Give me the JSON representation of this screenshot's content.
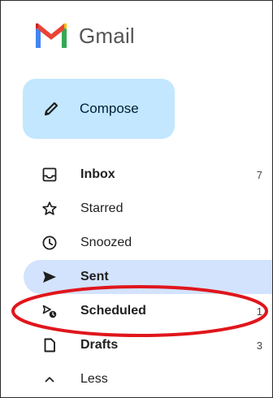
{
  "app": {
    "title": "Gmail",
    "logo_icon": "gmail-logo-icon"
  },
  "compose": {
    "label": "Compose",
    "icon": "pencil-icon",
    "color": "#c2e7ff"
  },
  "nav": {
    "items": [
      {
        "id": "inbox",
        "label": "Inbox",
        "icon": "inbox-icon",
        "count": "7",
        "bold": true
      },
      {
        "id": "starred",
        "label": "Starred",
        "icon": "star-icon",
        "count": "",
        "bold": false
      },
      {
        "id": "snoozed",
        "label": "Snoozed",
        "icon": "clock-icon",
        "count": "",
        "bold": false
      },
      {
        "id": "sent",
        "label": "Sent",
        "icon": "send-icon",
        "count": "",
        "bold": true,
        "active": true
      },
      {
        "id": "scheduled",
        "label": "Scheduled",
        "icon": "scheduled-icon",
        "count": "1",
        "bold": true
      },
      {
        "id": "drafts",
        "label": "Drafts",
        "icon": "draft-icon",
        "count": "3",
        "bold": true
      },
      {
        "id": "less",
        "label": "Less",
        "icon": "chevron-up-icon",
        "count": "",
        "bold": false
      }
    ],
    "active_color": "#d3e3fd"
  },
  "annotation": {
    "color": "#e0161c"
  }
}
